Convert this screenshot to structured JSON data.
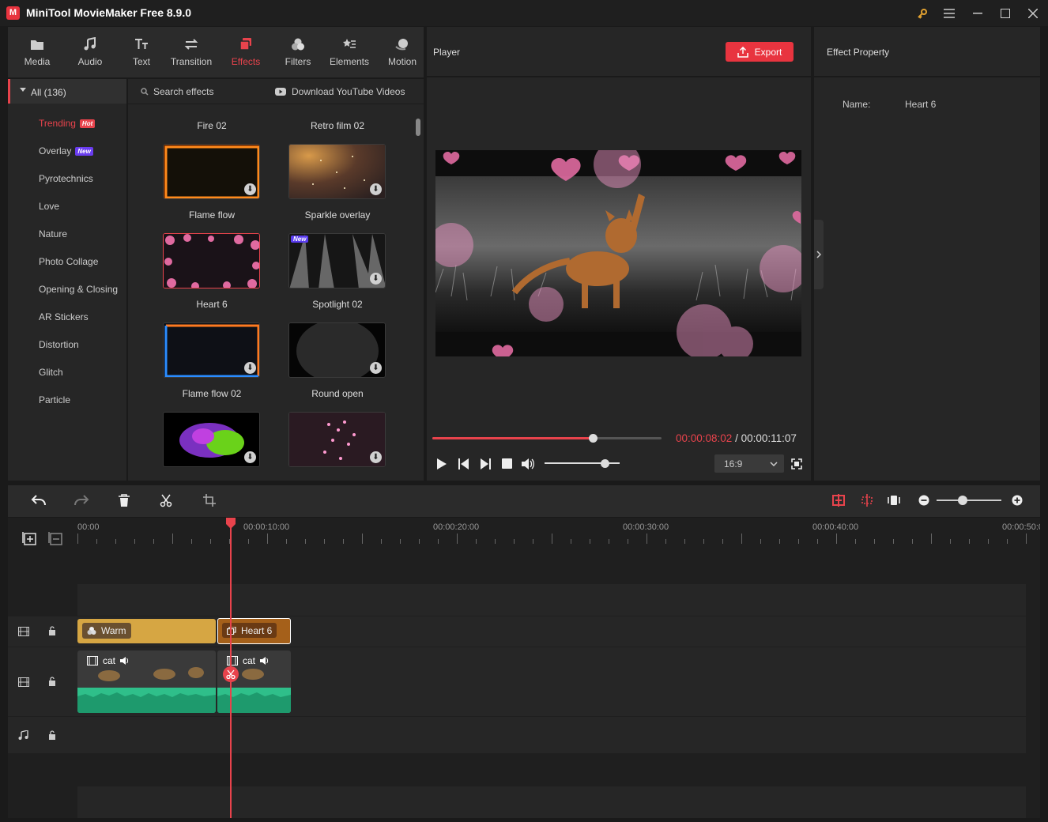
{
  "app": {
    "title": "MiniTool MovieMaker Free 8.9.0",
    "accent": "#e8434c"
  },
  "toolbar": {
    "items": [
      {
        "label": "Media",
        "icon": "media-icon"
      },
      {
        "label": "Audio",
        "icon": "music-icon"
      },
      {
        "label": "Text",
        "icon": "text-icon"
      },
      {
        "label": "Transition",
        "icon": "transition-icon"
      },
      {
        "label": "Effects",
        "icon": "effects-icon",
        "active": true
      },
      {
        "label": "Filters",
        "icon": "filters-icon"
      },
      {
        "label": "Elements",
        "icon": "elements-icon"
      },
      {
        "label": "Motion",
        "icon": "motion-icon"
      }
    ]
  },
  "categories": {
    "all": "All (136)",
    "items": [
      "Trending",
      "Overlay",
      "Pyrotechnics",
      "Love",
      "Nature",
      "Photo Collage",
      "Opening & Closing",
      "AR Stickers",
      "Distortion",
      "Glitch",
      "Particle"
    ],
    "badges": {
      "hot": "Hot",
      "new": "New"
    }
  },
  "effects_panel": {
    "search": "Search effects",
    "download_youtube": "Download YouTube Videos",
    "top_labels": [
      "Fire 02",
      "Retro film 02"
    ],
    "thumb_new_badge": "New",
    "items": [
      "Flame flow",
      "Sparkle overlay",
      "Heart 6",
      "Spotlight 02",
      "Flame flow 02",
      "Round open"
    ]
  },
  "player": {
    "title": "Player",
    "export": "Export",
    "current_time": "00:00:08:02",
    "separator": "/",
    "total_time": "00:00:11:07",
    "progress": 0.7,
    "volume": 0.8,
    "aspect": "16:9"
  },
  "property": {
    "title": "Effect Property",
    "name_label": "Name:",
    "name_value": "Heart 6"
  },
  "timeline": {
    "ruler": [
      "00:00",
      "00:00:10:00",
      "00:00:20:00",
      "00:00:30:00",
      "00:00:40:00",
      "00:00:50:0"
    ],
    "zoom": 0.4,
    "clips": {
      "filter": "Warm",
      "effect": "Heart 6",
      "video1": "cat",
      "video2": "cat"
    }
  }
}
